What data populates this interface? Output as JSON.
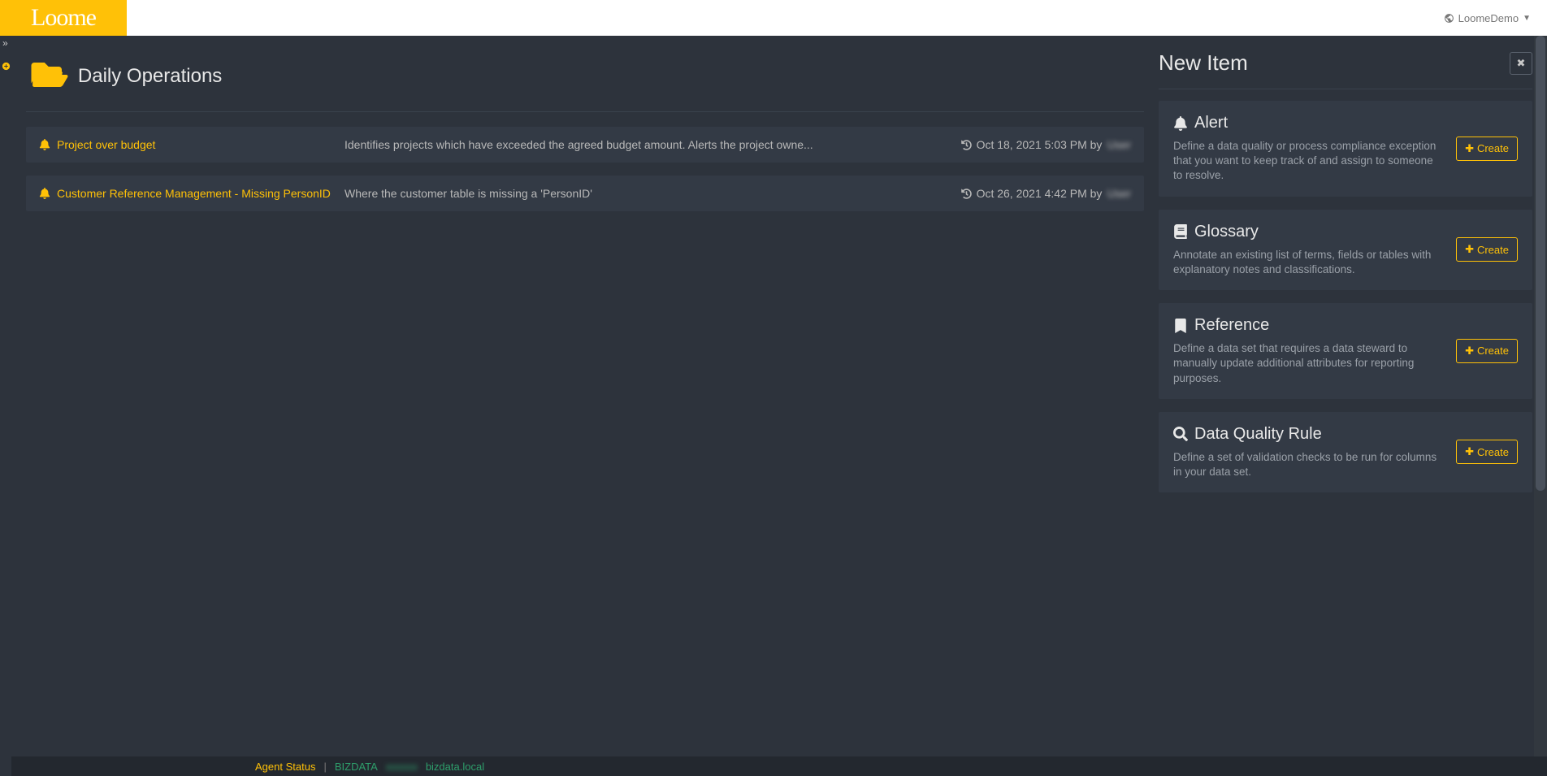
{
  "header": {
    "logo": "Loome",
    "tenant": "LoomeDemo"
  },
  "page": {
    "title": "Daily Operations"
  },
  "items": [
    {
      "name": "Project over budget",
      "description": "Identifies projects which have exceeded the agreed budget amount. Alerts the project owne...",
      "meta_prefix": "Oct 18, 2021 5:03 PM by ",
      "meta_user": "User"
    },
    {
      "name": "Customer Reference Management - Missing PersonID",
      "description": "Where the customer table is missing a 'PersonID'",
      "meta_prefix": "Oct 26, 2021 4:42 PM by ",
      "meta_user": "User"
    }
  ],
  "panel": {
    "title": "New Item",
    "cards": [
      {
        "title": "Alert",
        "desc": "Define a data quality or process compliance exception that you want to keep track of and assign to someone to resolve.",
        "button": "Create"
      },
      {
        "title": "Glossary",
        "desc": "Annotate an existing list of terms, fields or tables with explanatory notes and classifications.",
        "button": "Create"
      },
      {
        "title": "Reference",
        "desc": "Define a data set that requires a data steward to manually update additional attributes for reporting purposes.",
        "button": "Create"
      },
      {
        "title": "Data Quality Rule",
        "desc": "Define a set of validation checks to be run for columns in your data set.",
        "button": "Create"
      }
    ]
  },
  "footer": {
    "label": "Agent Status",
    "sep": "|",
    "agent": "BIZDATA",
    "agent_blur": "xxxxxx",
    "host": "bizdata.local"
  }
}
